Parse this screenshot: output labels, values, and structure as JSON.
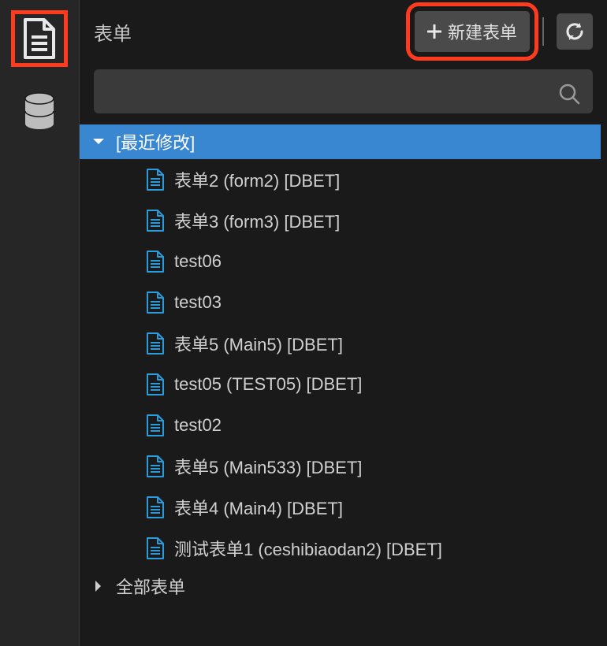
{
  "header": {
    "title": "表单",
    "new_form_label": "新建表单"
  },
  "search": {
    "placeholder": ""
  },
  "tree": {
    "groups": [
      {
        "label": "[最近修改]",
        "expanded": true,
        "selected": true,
        "items": [
          {
            "label": "表单2 (form2) [DBET]"
          },
          {
            "label": "表单3 (form3) [DBET]"
          },
          {
            "label": "test06"
          },
          {
            "label": "test03"
          },
          {
            "label": "表单5 (Main5) [DBET]"
          },
          {
            "label": "test05 (TEST05) [DBET]"
          },
          {
            "label": "test02"
          },
          {
            "label": "表单5 (Main533) [DBET]"
          },
          {
            "label": "表单4 (Main4) [DBET]"
          },
          {
            "label": "测试表单1 (ceshibiaodan2) [DBET]"
          }
        ]
      },
      {
        "label": "全部表单",
        "expanded": false,
        "selected": false,
        "items": []
      }
    ]
  },
  "colors": {
    "highlight": "#ff3b1f",
    "selection": "#3a87d1",
    "form_icon": "#2a9cdb"
  }
}
